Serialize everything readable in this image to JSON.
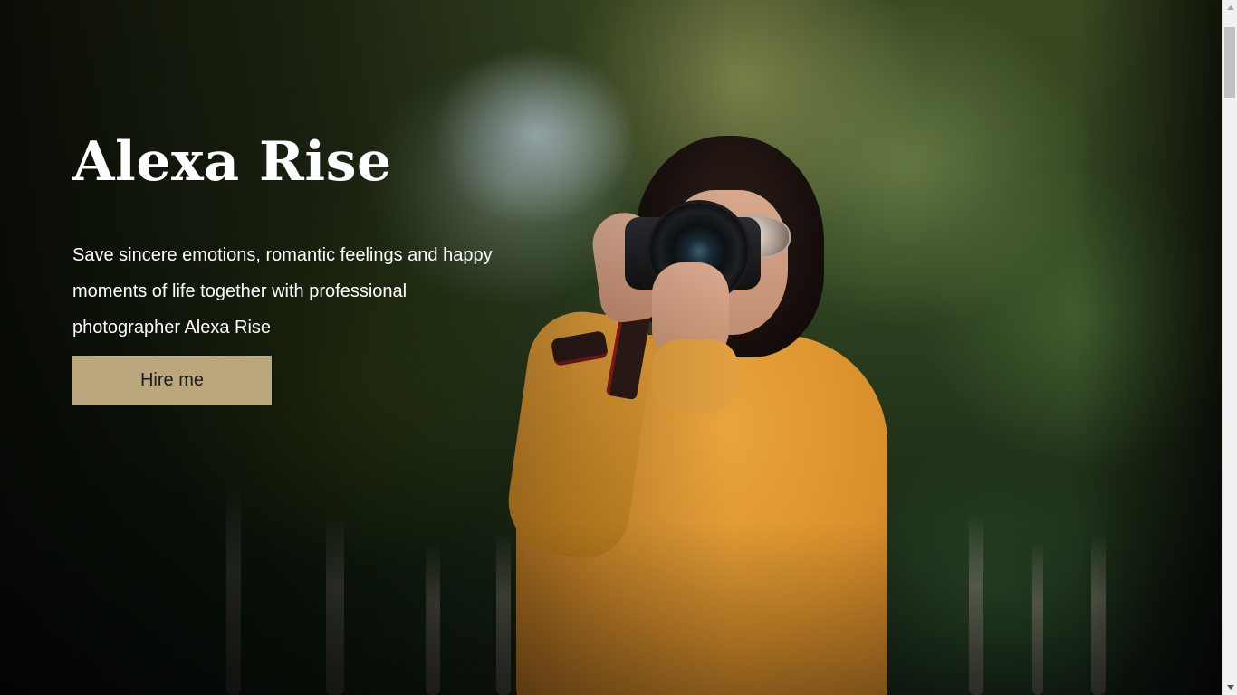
{
  "hero": {
    "title": "Alexa Rise",
    "description": "Save sincere emotions, romantic feelings and happy moments of life together with professional photographer Alexa Rise",
    "button_label": "Hire me"
  },
  "colors": {
    "button_background": "#bba77e",
    "title_text": "#ffffff",
    "sweater": "#e09a35"
  },
  "icons": {
    "scroll_up": "arrow-up-icon",
    "scroll_down": "arrow-down-icon"
  }
}
